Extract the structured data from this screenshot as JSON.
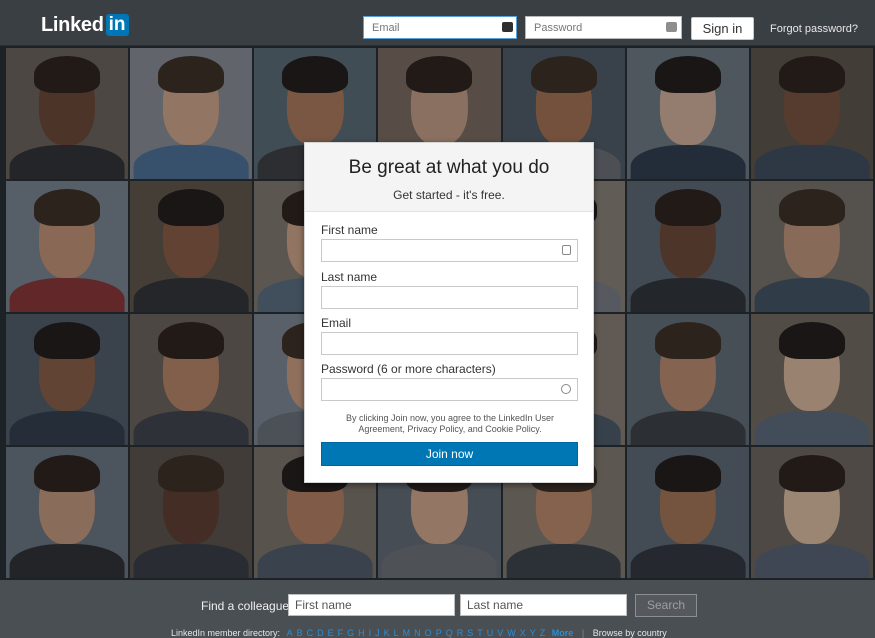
{
  "header": {
    "logo_text": "Linked",
    "logo_box": "in",
    "email_placeholder": "Email",
    "password_placeholder": "Password",
    "signin_label": "Sign in",
    "forgot_label": "Forgot password?"
  },
  "signup": {
    "title": "Be great at what you do",
    "subtitle": "Get started - it's free.",
    "first_name_label": "First name",
    "last_name_label": "Last name",
    "email_label": "Email",
    "password_label": "Password (6 or more characters)",
    "terms": "By clicking Join now, you agree to the LinkedIn User Agreement, Privacy Policy, and Cookie Policy.",
    "join_label": "Join now"
  },
  "footer": {
    "find_label": "Find a colleague",
    "first_placeholder": "First name",
    "last_placeholder": "Last name",
    "search_label": "Search",
    "directory_label": "LinkedIn member directory:",
    "letters": [
      "A",
      "B",
      "C",
      "D",
      "E",
      "F",
      "G",
      "H",
      "I",
      "J",
      "K",
      "L",
      "M",
      "N",
      "O",
      "P",
      "Q",
      "R",
      "S",
      "T",
      "U",
      "V",
      "W",
      "X",
      "Y",
      "Z"
    ],
    "more_label": "More",
    "browse_label": "Browse by country"
  },
  "colors": {
    "brand_blue": "#0077b5",
    "topbar": "#3a3f44",
    "footer": "#4a4f54"
  }
}
